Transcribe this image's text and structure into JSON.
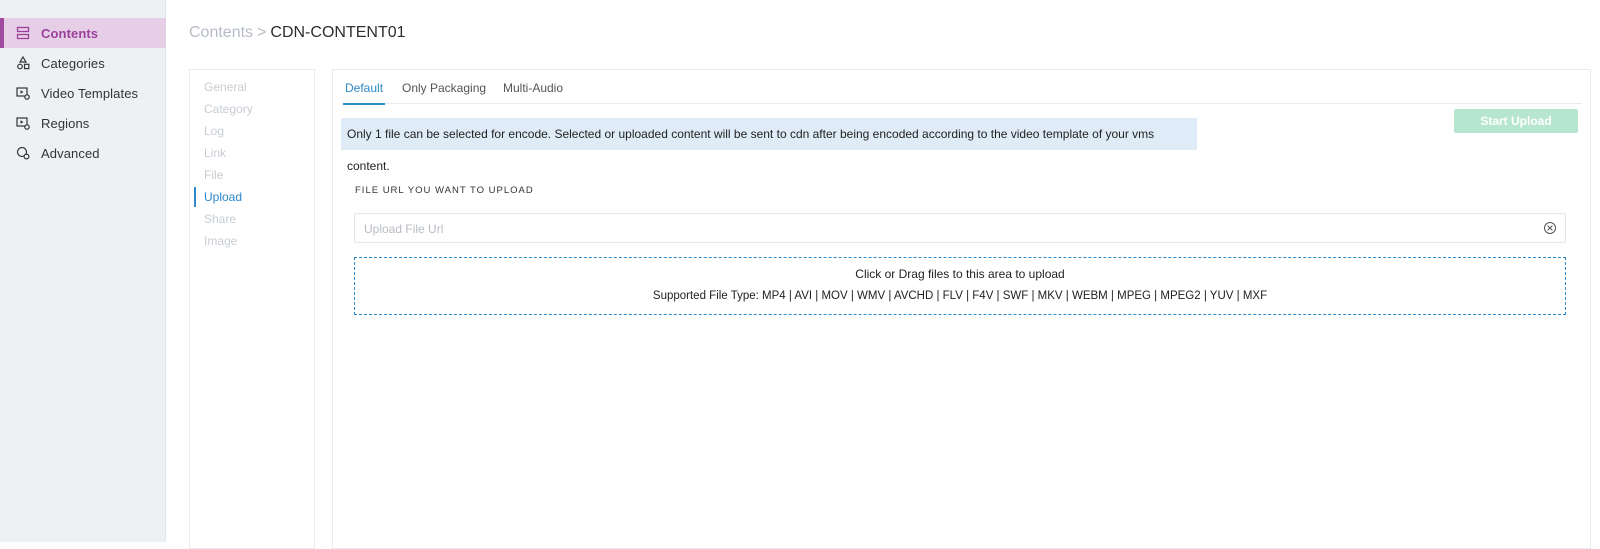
{
  "sidebar": {
    "items": [
      {
        "label": "Contents",
        "icon": "rows-icon",
        "active": true
      },
      {
        "label": "Categories",
        "icon": "shapes-icon"
      },
      {
        "label": "Video Templates",
        "icon": "video-settings-icon"
      },
      {
        "label": "Regions",
        "icon": "video-settings-icon"
      },
      {
        "label": "Advanced",
        "icon": "advanced-settings-icon"
      }
    ]
  },
  "breadcrumb": {
    "parent": "Contents",
    "separator": ">",
    "current": "CDN-CONTENT01"
  },
  "subnav": {
    "items": [
      "General",
      "Category",
      "Log",
      "Link",
      "File",
      "Upload",
      "Share",
      "Image"
    ],
    "active": "Upload"
  },
  "tabs": {
    "items": [
      "Default",
      "Only Packaging",
      "Multi-Audio"
    ],
    "active": "Default"
  },
  "start_upload_label": "Start Upload",
  "info_text": "Only 1 file can be selected for encode. Selected or uploaded content will be sent to cdn after being encoded according to the video template of your vms content.",
  "url_field": {
    "label": "FILE URL YOU WANT TO UPLOAD",
    "placeholder": "Upload File Url",
    "value": ""
  },
  "dropzone": {
    "title": "Click or Drag files to this area to upload",
    "types": "Supported File Type: MP4 | AVI | MOV | WMV | AVCHD | FLV | F4V | SWF | MKV | WEBM | MPEG | MPEG2 | YUV | MXF"
  },
  "colors": {
    "accent_purple": "#a04aa0",
    "active_bg": "#e6cfe6",
    "link_blue": "#2e89c9",
    "button_green": "#b7e6cf",
    "info_bg": "#dfecf7"
  }
}
